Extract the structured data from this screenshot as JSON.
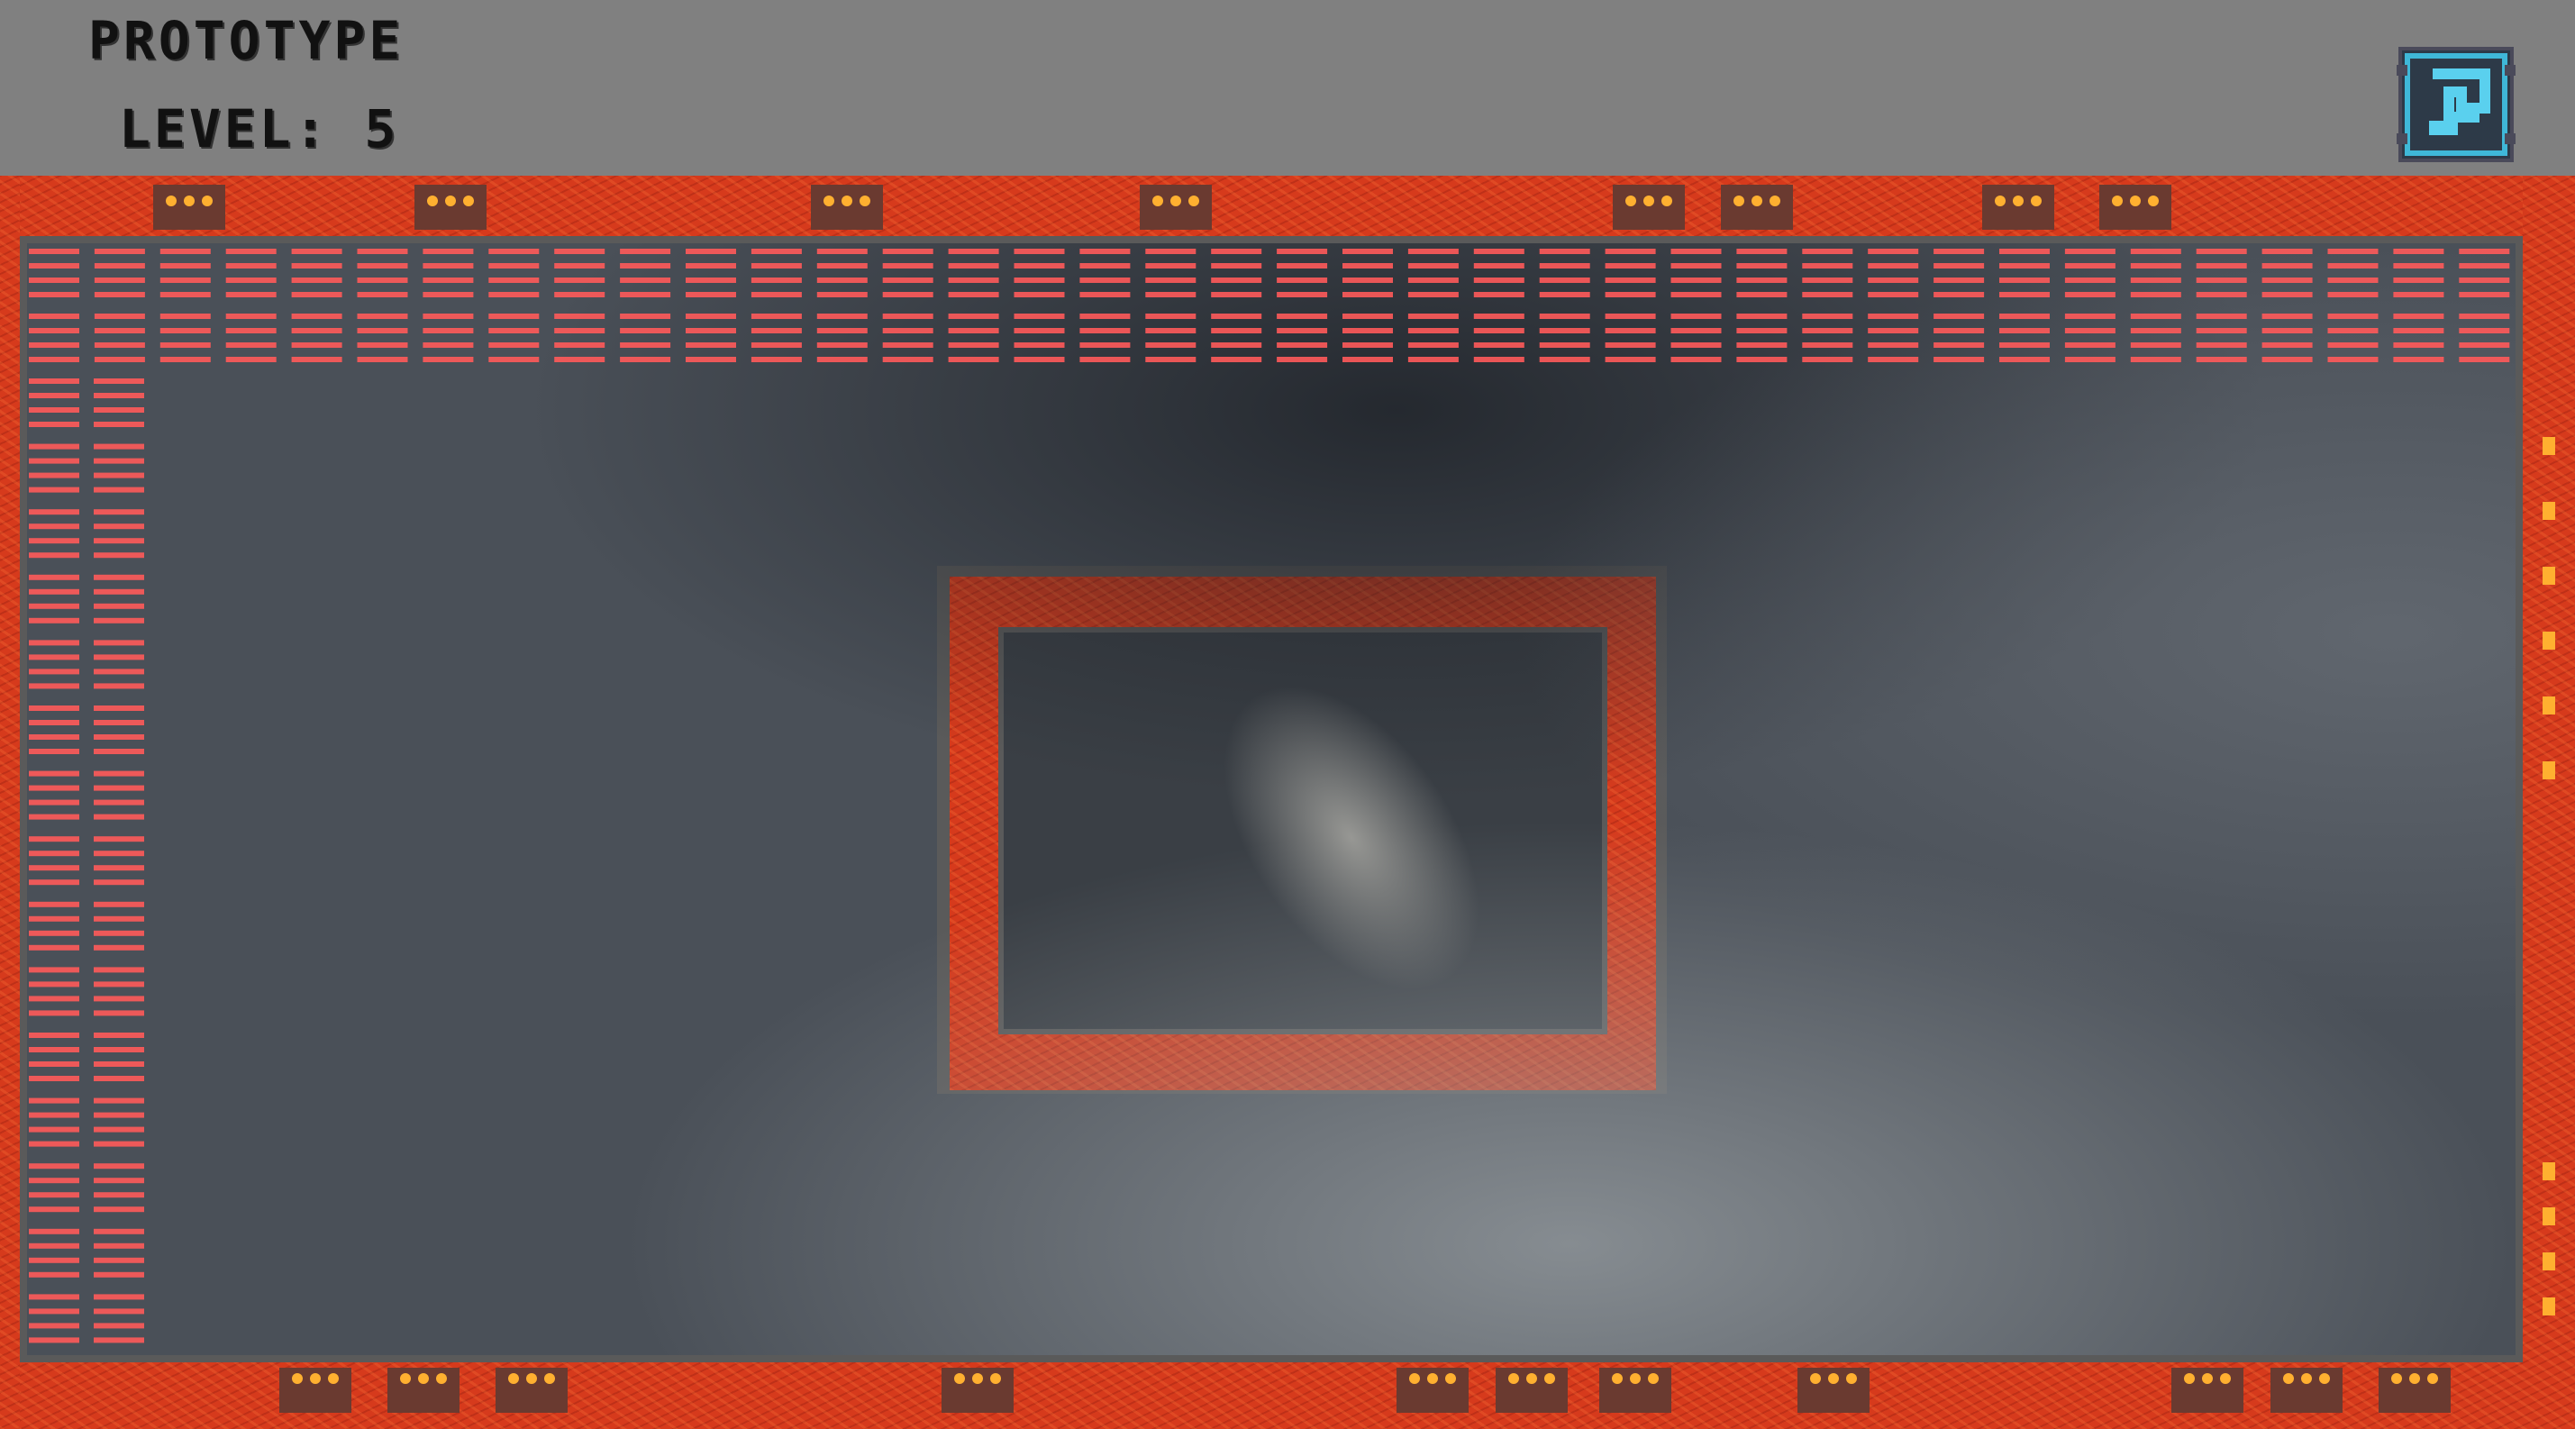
{
  "hud": {
    "title": "PROTOTYPE",
    "level_text": "LEVEL: 5",
    "menu_icon": "level-select-icon",
    "menu_icon_color": "#3fb8d8"
  },
  "arena": {
    "lava_color": "#d63a1c",
    "brick_color": "#ff5a5a",
    "floor_color": "#4a5058",
    "wall_color": "#5a5a5a"
  },
  "bricks": {
    "top_rows": 4,
    "top_columns": 38,
    "left_rows": 30,
    "left_columns": 2
  }
}
